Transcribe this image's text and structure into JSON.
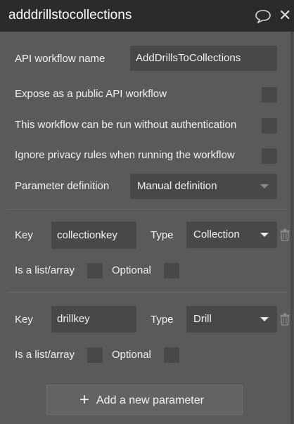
{
  "header": {
    "title": "adddrillstocollections"
  },
  "workflow": {
    "name_label": "API workflow name",
    "name_value": "AddDrillsToCollections",
    "expose_label": "Expose as a public API workflow",
    "noauth_label": "This workflow can be run without authentication",
    "ignore_privacy_label": "Ignore privacy rules when running the workflow",
    "param_def_label": "Parameter definition",
    "param_def_value": "Manual definition"
  },
  "params": [
    {
      "key_label": "Key",
      "key_value": "collectionkey",
      "type_label": "Type",
      "type_value": "Collection",
      "list_label": "Is a list/array",
      "optional_label": "Optional"
    },
    {
      "key_label": "Key",
      "key_value": "drillkey",
      "type_label": "Type",
      "type_value": "Drill",
      "list_label": "Is a list/array",
      "optional_label": "Optional"
    }
  ],
  "add_button": {
    "label": "Add a new parameter"
  },
  "icons": {
    "comment": "comment-icon",
    "close": "close-icon",
    "trash": "trash-icon",
    "plus": "plus-icon"
  },
  "colors": {
    "header_bg": "#2b2b2b",
    "panel_bg": "#5a5a5a",
    "field_bg": "#484848"
  }
}
